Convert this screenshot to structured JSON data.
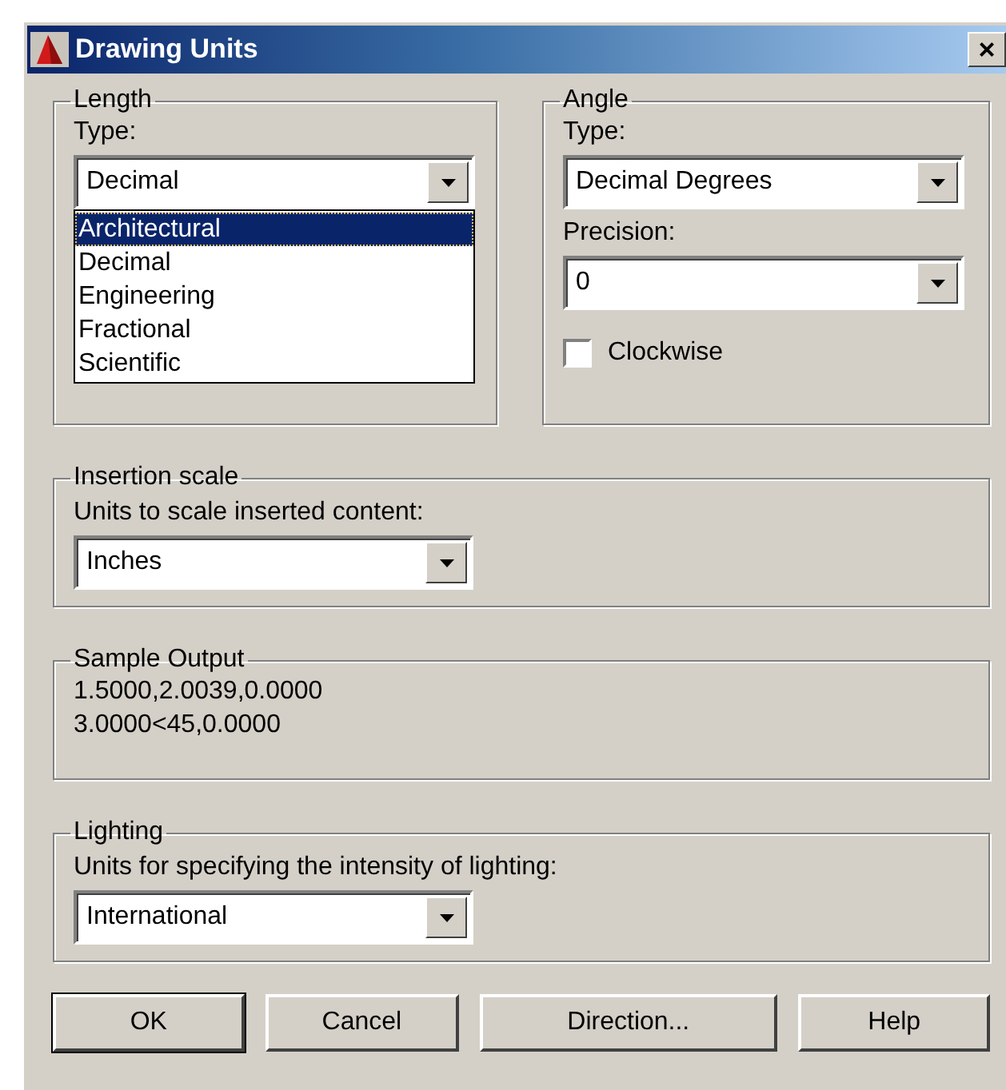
{
  "window": {
    "title": "Drawing Units",
    "close": "×"
  },
  "length": {
    "title": "Length",
    "type_label": "Type:",
    "type_value": "Decimal",
    "dropdown_open": true,
    "options": [
      {
        "label": "Architectural",
        "selected": true
      },
      {
        "label": "Decimal",
        "selected": false
      },
      {
        "label": "Engineering",
        "selected": false
      },
      {
        "label": "Fractional",
        "selected": false
      },
      {
        "label": "Scientific",
        "selected": false
      }
    ]
  },
  "angle": {
    "title": "Angle",
    "type_label": "Type:",
    "type_value": "Decimal Degrees",
    "precision_label": "Precision:",
    "precision_value": "0",
    "clockwise": {
      "label": "Clockwise",
      "checked": false
    }
  },
  "insertion_scale": {
    "title": "Insertion scale",
    "label": "Units to scale inserted content:",
    "value": "Inches"
  },
  "sample_output": {
    "title": "Sample Output",
    "lines": [
      "1.5000,2.0039,0.0000",
      "3.0000<45,0.0000"
    ]
  },
  "lighting": {
    "title": "Lighting",
    "label": "Units for specifying the intensity of lighting:",
    "value": "International"
  },
  "buttons": [
    {
      "label": "OK",
      "default": true
    },
    {
      "label": "Cancel",
      "default": false
    },
    {
      "label": "Direction...",
      "default": false
    },
    {
      "label": "Help",
      "default": false
    }
  ]
}
